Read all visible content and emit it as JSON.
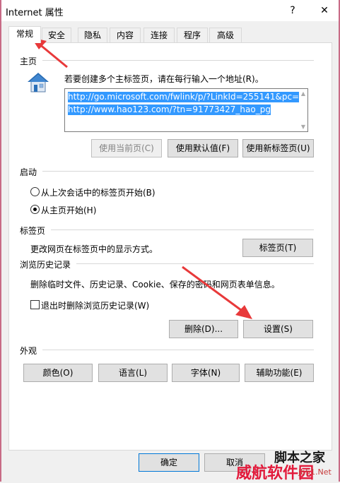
{
  "window": {
    "title": "Internet 属性",
    "help_label": "?",
    "close_label": "✕"
  },
  "tabs": [
    {
      "label": "常规"
    },
    {
      "label": "安全"
    },
    {
      "label": "隐私"
    },
    {
      "label": "内容"
    },
    {
      "label": "连接"
    },
    {
      "label": "程序"
    },
    {
      "label": "高级"
    }
  ],
  "home": {
    "section": "主页",
    "instruction": "若要创建多个主标签页，请在每行输入一个地址(R)。",
    "urls": [
      "http://go.microsoft.com/fwlink/p/?LinkId=255141&pc=",
      "http://www.hao123.com/?tn=91773427_hao_pg"
    ],
    "buttons": {
      "use_current": "使用当前页(C)",
      "use_default": "使用默认值(F)",
      "use_new_tab": "使用新标签页(U)"
    }
  },
  "startup": {
    "section": "启动",
    "option1": "从上次会话中的标签页开始(B)",
    "option2": "从主页开始(H)",
    "selected": 2
  },
  "tabs_section": {
    "section": "标签页",
    "description": "更改网页在标签页中的显示方式。",
    "button": "标签页(T)"
  },
  "history": {
    "section": "浏览历史记录",
    "description": "删除临时文件、历史记录、Cookie、保存的密码和网页表单信息。",
    "checkbox": "退出时删除浏览历史记录(W)",
    "delete_button": "删除(D)...",
    "settings_button": "设置(S)"
  },
  "appearance": {
    "section": "外观",
    "colors": "颜色(O)",
    "languages": "语言(L)",
    "fonts": "字体(N)",
    "accessibility": "辅助功能(E)"
  },
  "footer": {
    "ok": "确定",
    "cancel": "取消"
  },
  "watermark": {
    "line1": "脚本之家",
    "line2": "威航软件园",
    "line3": "jb51.Net"
  },
  "colors": {
    "accent_arrow": "#e8393a",
    "selection": "#3399ff"
  }
}
